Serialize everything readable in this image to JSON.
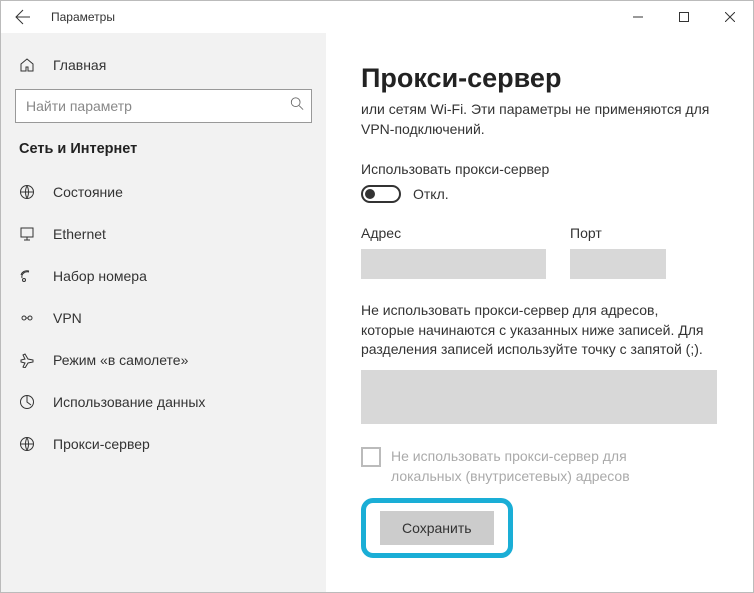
{
  "titlebar": {
    "title": "Параметры"
  },
  "sidebar": {
    "home": "Главная",
    "search_placeholder": "Найти параметр",
    "section": "Сеть и Интернет",
    "items": [
      {
        "label": "Состояние"
      },
      {
        "label": "Ethernet"
      },
      {
        "label": "Набор номера"
      },
      {
        "label": "VPN"
      },
      {
        "label": "Режим «в самолете»"
      },
      {
        "label": "Использование данных"
      },
      {
        "label": "Прокси-сервер"
      }
    ]
  },
  "main": {
    "heading": "Прокси-сервер",
    "subtext": "или сетям Wi-Fi. Эти параметры не применяются для VPN-подключений.",
    "use_proxy_label": "Использовать прокси-сервер",
    "toggle_state": "Откл.",
    "address_label": "Адрес",
    "port_label": "Порт",
    "exceptions_text": "Не использовать прокси-сервер для адресов, которые начинаются с указанных ниже записей. Для разделения записей используйте точку с запятой (;).",
    "local_checkbox_label": "Не использовать прокси-сервер для локальных (внутрисетевых) адресов",
    "save_button": "Сохранить"
  }
}
